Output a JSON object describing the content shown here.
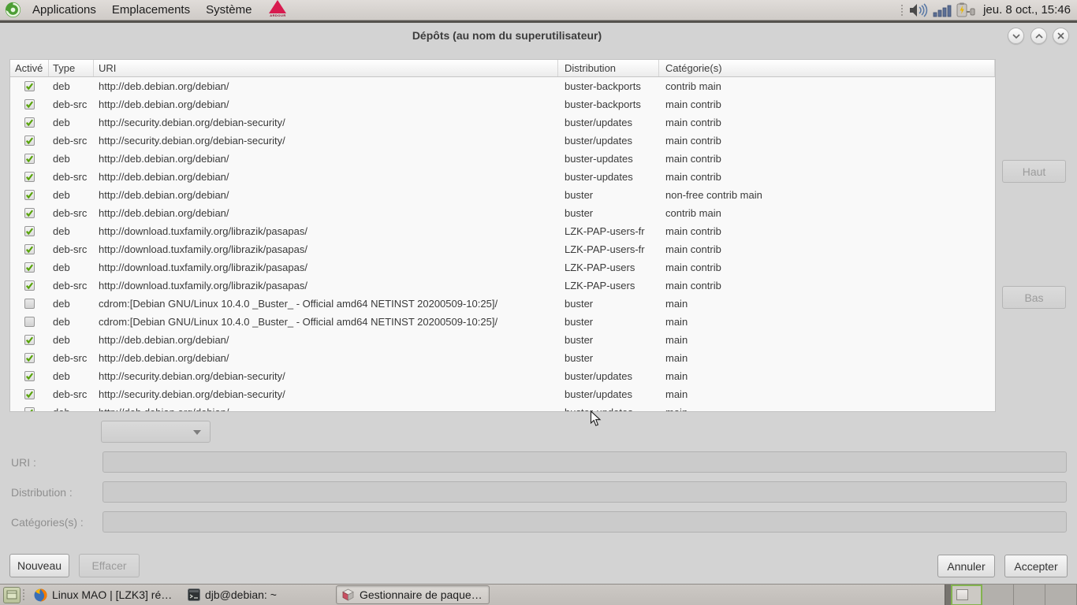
{
  "top_panel": {
    "menus": [
      {
        "label": "Applications"
      },
      {
        "label": "Emplacements"
      },
      {
        "label": "Système"
      }
    ],
    "ardour_label": "ARDOUR",
    "clock": "jeu. 8 oct., 15:46"
  },
  "dialog": {
    "title": "Dépôts (au nom du superutilisateur)",
    "table": {
      "columns": [
        "Activé",
        "Type",
        "URI",
        "Distribution",
        "Catégorie(s)"
      ],
      "rows": [
        {
          "enabled": true,
          "type": "deb",
          "uri": "http://deb.debian.org/debian/",
          "distribution": "buster-backports",
          "categories": "contrib main"
        },
        {
          "enabled": true,
          "type": "deb-src",
          "uri": "http://deb.debian.org/debian/",
          "distribution": "buster-backports",
          "categories": "main contrib"
        },
        {
          "enabled": true,
          "type": "deb",
          "uri": "http://security.debian.org/debian-security/",
          "distribution": "buster/updates",
          "categories": "main contrib"
        },
        {
          "enabled": true,
          "type": "deb-src",
          "uri": "http://security.debian.org/debian-security/",
          "distribution": "buster/updates",
          "categories": "main contrib"
        },
        {
          "enabled": true,
          "type": "deb",
          "uri": "http://deb.debian.org/debian/",
          "distribution": "buster-updates",
          "categories": "main contrib"
        },
        {
          "enabled": true,
          "type": "deb-src",
          "uri": "http://deb.debian.org/debian/",
          "distribution": "buster-updates",
          "categories": "main contrib"
        },
        {
          "enabled": true,
          "type": "deb",
          "uri": "http://deb.debian.org/debian/",
          "distribution": "buster",
          "categories": "non-free contrib main"
        },
        {
          "enabled": true,
          "type": "deb-src",
          "uri": "http://deb.debian.org/debian/",
          "distribution": "buster",
          "categories": "contrib main"
        },
        {
          "enabled": true,
          "type": "deb",
          "uri": "http://download.tuxfamily.org/librazik/pasapas/",
          "distribution": "LZK-PAP-users-fr",
          "categories": "main contrib"
        },
        {
          "enabled": true,
          "type": "deb-src",
          "uri": "http://download.tuxfamily.org/librazik/pasapas/",
          "distribution": "LZK-PAP-users-fr",
          "categories": "main contrib"
        },
        {
          "enabled": true,
          "type": "deb",
          "uri": "http://download.tuxfamily.org/librazik/pasapas/",
          "distribution": "LZK-PAP-users",
          "categories": "main contrib"
        },
        {
          "enabled": true,
          "type": "deb-src",
          "uri": "http://download.tuxfamily.org/librazik/pasapas/",
          "distribution": "LZK-PAP-users",
          "categories": "main contrib"
        },
        {
          "enabled": false,
          "type": "deb",
          "uri": "cdrom:[Debian GNU/Linux 10.4.0 _Buster_ - Official amd64 NETINST 20200509-10:25]/",
          "distribution": "buster",
          "categories": "main"
        },
        {
          "enabled": false,
          "type": "deb",
          "uri": "cdrom:[Debian GNU/Linux 10.4.0 _Buster_ - Official amd64 NETINST 20200509-10:25]/",
          "distribution": "buster",
          "categories": "main"
        },
        {
          "enabled": true,
          "type": "deb",
          "uri": "http://deb.debian.org/debian/",
          "distribution": "buster",
          "categories": "main"
        },
        {
          "enabled": true,
          "type": "deb-src",
          "uri": "http://deb.debian.org/debian/",
          "distribution": "buster",
          "categories": "main"
        },
        {
          "enabled": true,
          "type": "deb",
          "uri": "http://security.debian.org/debian-security/",
          "distribution": "buster/updates",
          "categories": "main"
        },
        {
          "enabled": true,
          "type": "deb-src",
          "uri": "http://security.debian.org/debian-security/",
          "distribution": "buster/updates",
          "categories": "main"
        },
        {
          "enabled": true,
          "type": "deb",
          "uri": "http://deb.debian.org/debian/",
          "distribution": "buster-updates",
          "categories": "main"
        }
      ]
    },
    "side_buttons": {
      "up": "Haut",
      "down": "Bas"
    },
    "form": {
      "uri_label": "URI :",
      "distribution_label": "Distribution :",
      "categories_label": "Catégories(s) :",
      "uri_value": "",
      "distribution_value": "",
      "categories_value": ""
    },
    "action_buttons": {
      "new": "Nouveau",
      "delete": "Effacer",
      "cancel": "Annuler",
      "accept": "Accepter"
    }
  },
  "taskbar": {
    "tasks": [
      {
        "label": "Linux MAO | [LZK3] ré…",
        "icon": "firefox-icon",
        "active": false
      },
      {
        "label": "djb@debian: ~",
        "icon": "terminal-icon",
        "active": false
      },
      {
        "label": "Gestionnaire de paque…",
        "icon": "synaptic-icon",
        "active": true
      }
    ],
    "workspaces": {
      "count": 4,
      "active_index": 0
    }
  },
  "colors": {
    "check_green": "#57a309",
    "ardour_red": "#d81b4f",
    "dialog_bg": "#d3d3d3"
  }
}
